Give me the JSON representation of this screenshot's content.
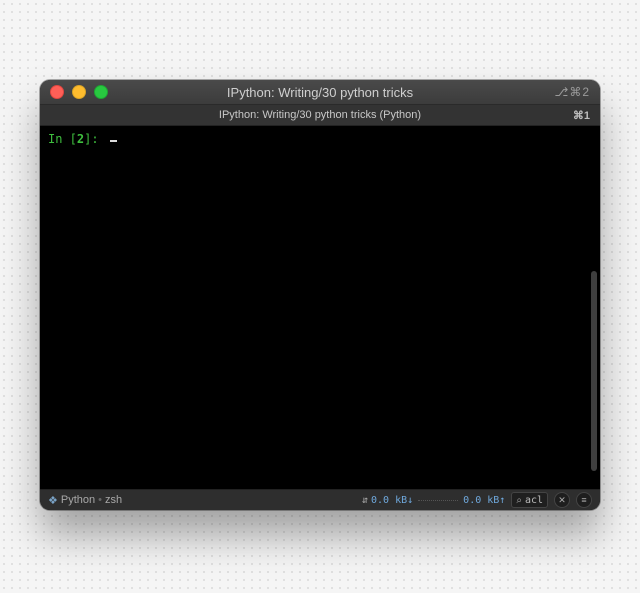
{
  "titlebar": {
    "title": "IPython: Writing/30 python tricks",
    "right": "⎇⌘2"
  },
  "tabbar": {
    "title": "IPython: Writing/30 python tricks (Python)",
    "right": "⌘1"
  },
  "terminal": {
    "prompt_prefix": "In [",
    "prompt_number": "2",
    "prompt_suffix": "]:"
  },
  "statusbar": {
    "lang_icon": "❖",
    "lang": "Python",
    "sep": "•",
    "shell": "zsh",
    "net_icon": "⇵",
    "net_down": "0.0 kB↓",
    "net_up": "0.0 kB↑",
    "search_icon": "⌕",
    "search_value": "acl",
    "close_icon": "✕",
    "menu_icon": "≡"
  }
}
